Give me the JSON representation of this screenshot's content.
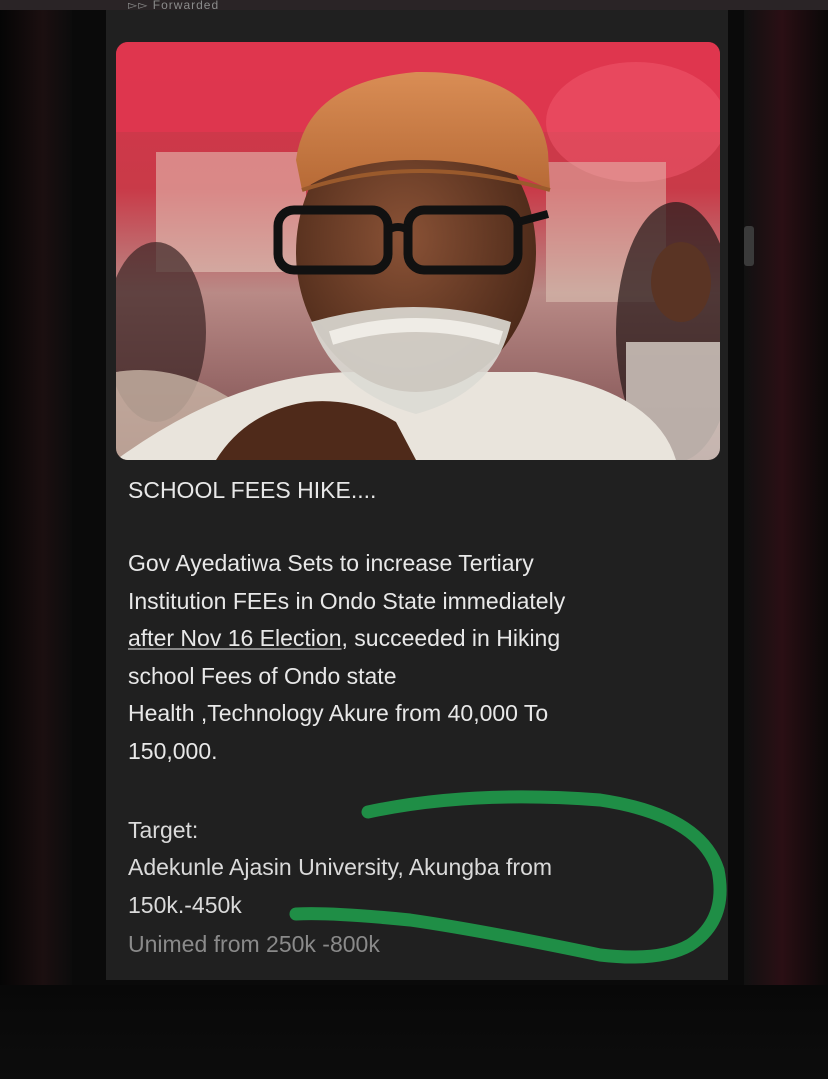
{
  "post": {
    "header_hint": "▻▻ Forwarded",
    "photo_alt": "",
    "headline": "SCHOOL FEES HIKE....",
    "body_lines": [
      "Gov Ayedatiwa Sets to increase Tertiary",
      "Institution FEEs in Ondo State immediately",
      "after Nov 16 Election",
      ", succeeded in Hiking",
      "school Fees of Ondo state",
      "Health ,Technology Akure from 40,000 To",
      "150,000."
    ],
    "target_label": "Target:",
    "target_lines": [
      "Adekunle Ajasin University, Akungba from",
      "150k.-450k"
    ],
    "dim_line": "Unimed from 250k -800k"
  },
  "colors": {
    "background": "#0a0a0a",
    "card": "#202020",
    "text": "#e8e8e8",
    "marker": "#1f9a4a"
  }
}
